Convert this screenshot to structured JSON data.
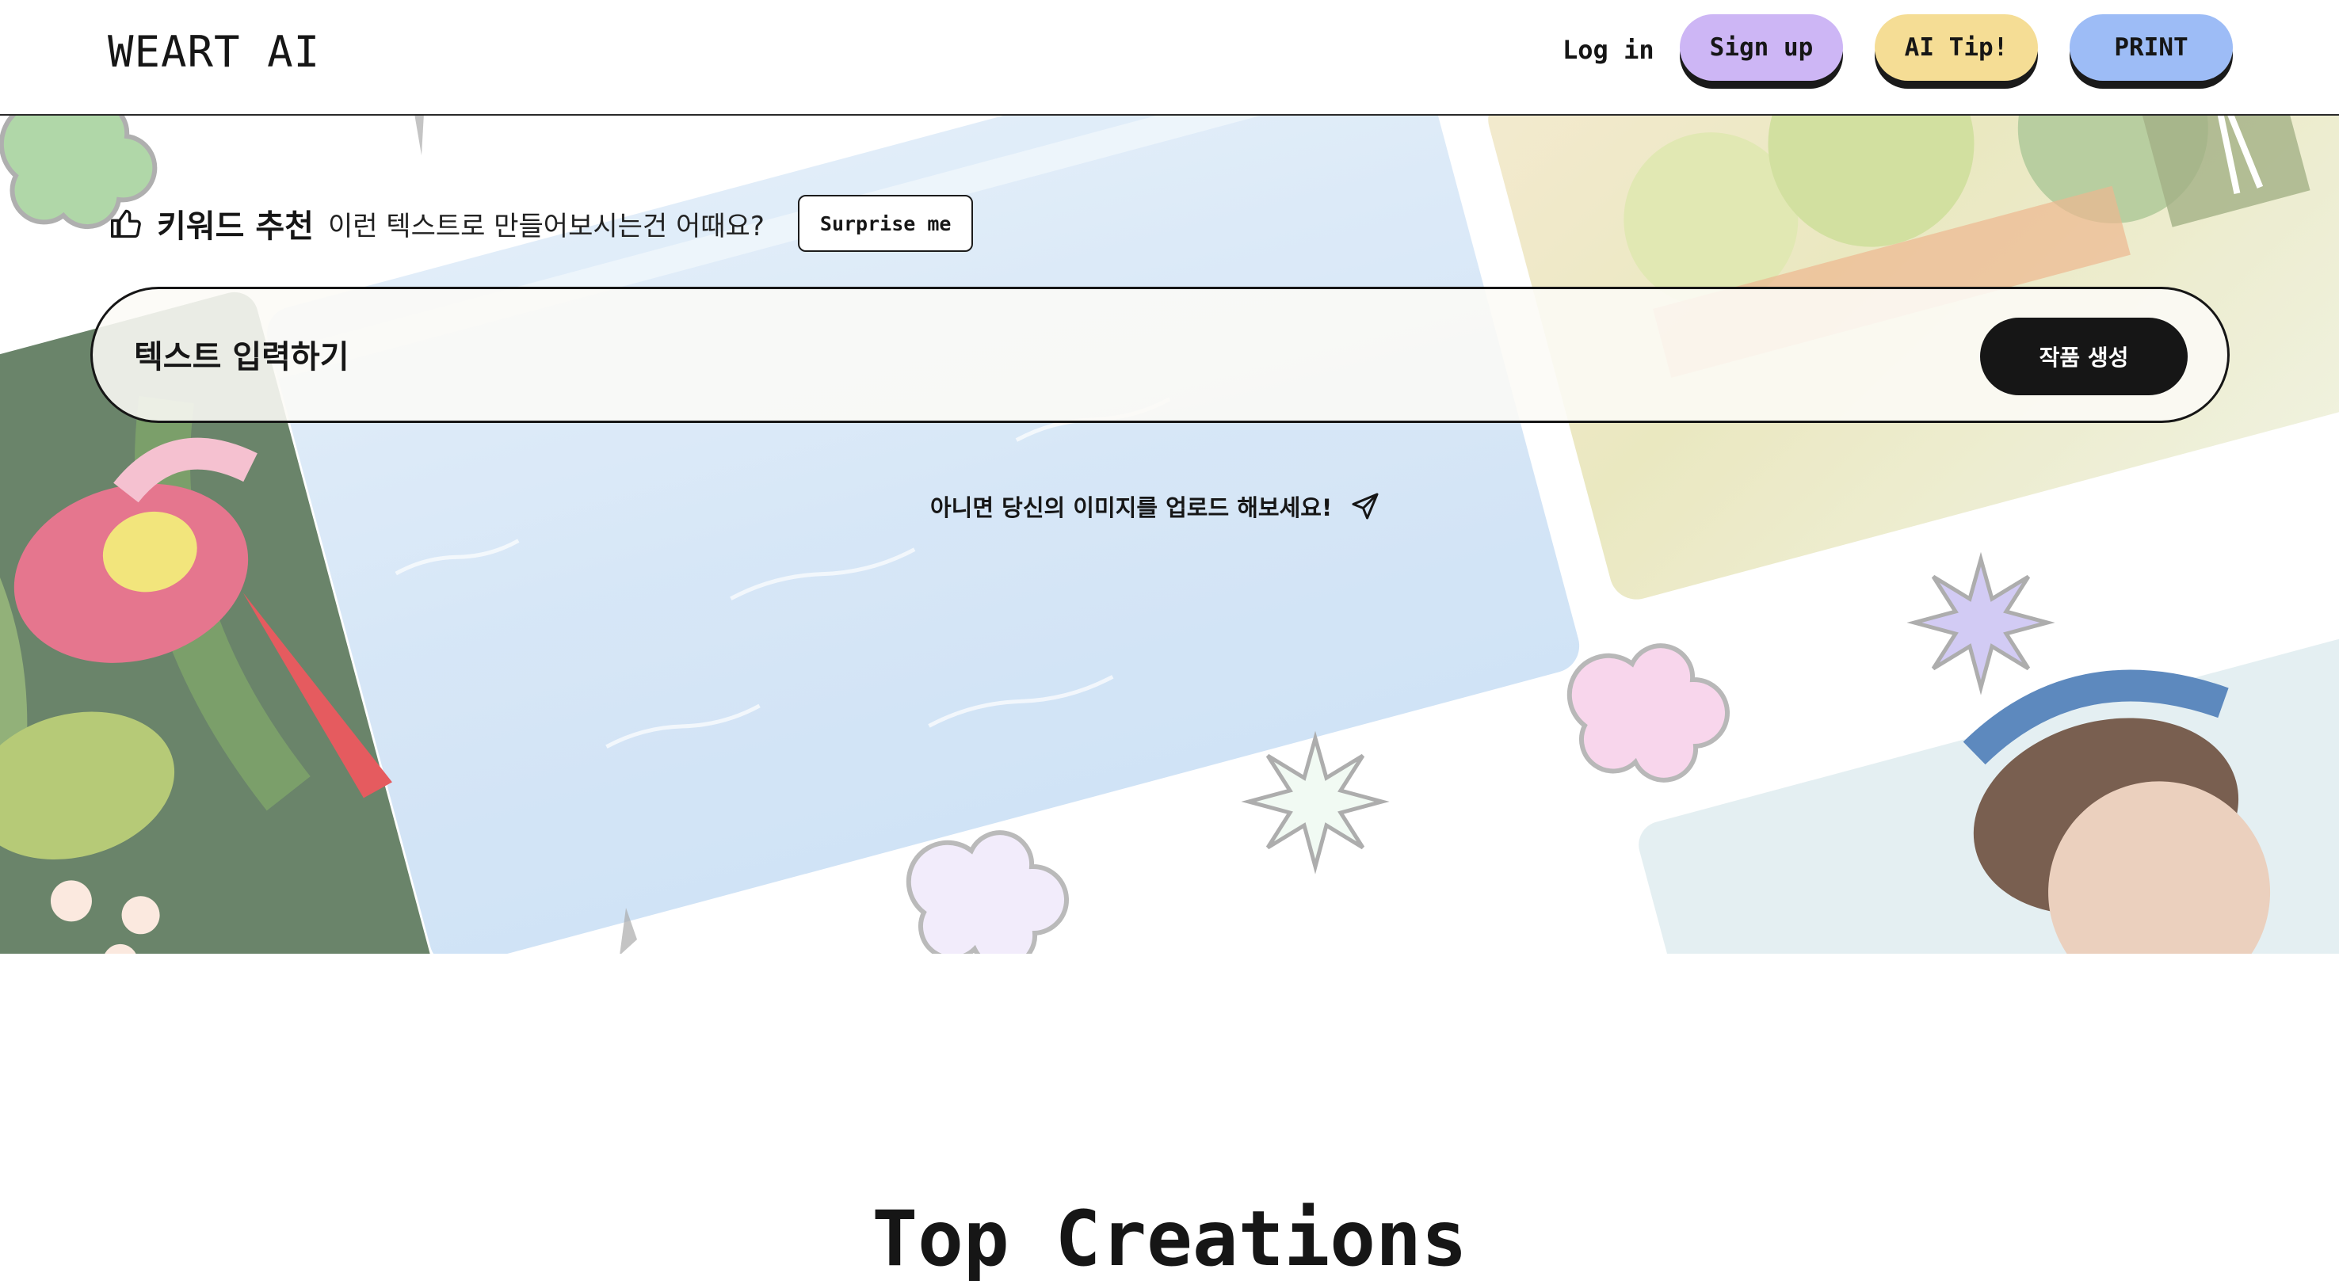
{
  "header": {
    "logo": "WEART AI",
    "login_label": "Log in",
    "signup_label": "Sign up",
    "tip_label": "AI Tip!",
    "print_label": "PRINT"
  },
  "hero": {
    "keyword_title": "키워드 추천",
    "keyword_subtitle": "이런 텍스트로 만들어보시는건 어때요?",
    "surprise_label": "Surprise me",
    "prompt_placeholder": "텍스트 입력하기",
    "generate_label": "작품 생성",
    "upload_text": "아니면 당신의 이미지를 업로드 해보세요!"
  },
  "section": {
    "title": "Top Creations"
  },
  "icons": {
    "keyword": "thumbs-up-icon",
    "upload": "send-icon"
  },
  "colors": {
    "signup": "#cdb6f5",
    "tip": "#f5dd95",
    "print": "#9dbcf6",
    "dark": "#161616"
  }
}
